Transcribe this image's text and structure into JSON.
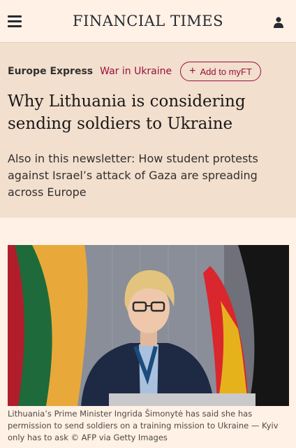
{
  "header": {
    "masthead": "FINANCIAL TIMES",
    "menu_icon": "hamburger-menu-icon",
    "user_icon": "user-account-icon"
  },
  "article": {
    "newsletter": "Europe Express",
    "topic": "War in Ukraine",
    "add_myft": "Add to myFT",
    "headline": "Why Lithuania is considering sending soldiers to Ukraine",
    "standfirst": "Also in this newsletter: How student protests against Israel’s attack of Gaza are spreading across Europe",
    "image_caption": "Lithuania’s Prime Minister Ingrida Šimonytė has said she has permission to send soldiers on a training mission to Ukraine — Kyiv only has to ask © AFP via Getty Images"
  },
  "colors": {
    "page_background": "#fff1e5",
    "hero_background": "#f2dfce",
    "accent": "#990f3d",
    "text": "#33302e"
  }
}
